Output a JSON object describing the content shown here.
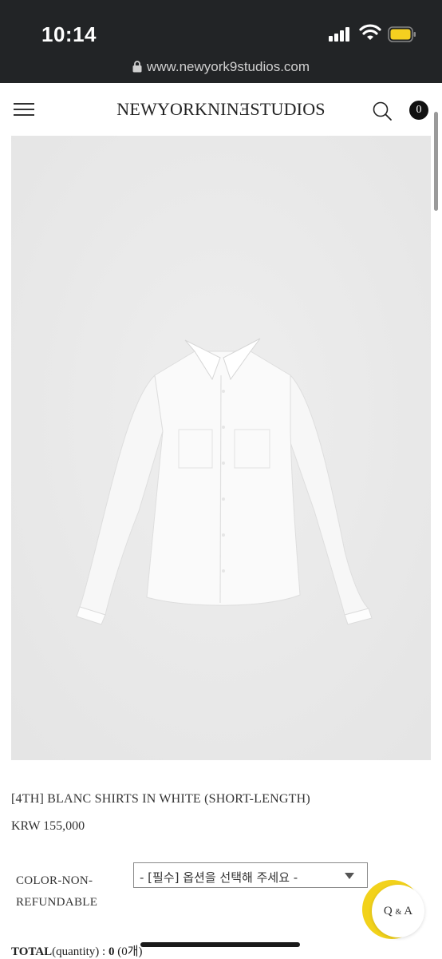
{
  "status_bar": {
    "time": "10:14",
    "url": "www.newyork9studios.com"
  },
  "header": {
    "logo": "NEWYORKNINƎSTUDIOS",
    "cart_count": "0"
  },
  "product": {
    "name": "[4TH] BLANC SHIRTS IN WHITE (SHORT-LENGTH)",
    "price": "KRW 155,000",
    "option_label_line1": "COLOR-NON-",
    "option_label_line2": "REFUNDABLE",
    "option_select_value": "- [필수] 옵션을 선택해 주세요 -"
  },
  "qa_button": {
    "q": "Q",
    "amp": "&",
    "a": "A"
  },
  "total": {
    "label": "TOTAL",
    "quantity_label": "(quantity) : ",
    "amount": "0",
    "count": " (0개)"
  }
}
